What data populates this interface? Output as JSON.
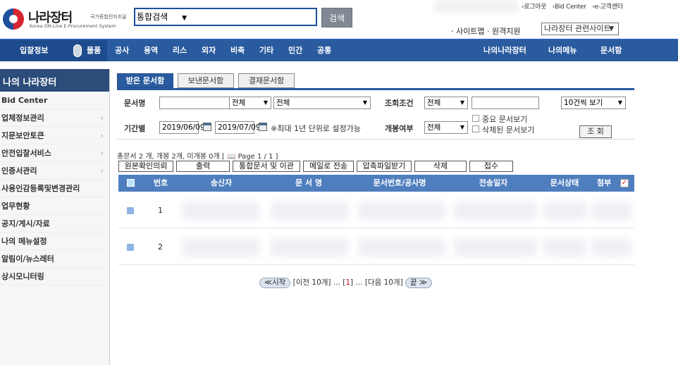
{
  "header": {
    "logo_name": "나라장터",
    "logo_tag": "국가종합전자조달",
    "logo_eng": "Korea ON-Line E-Procurement System",
    "search_scope": "통합검색",
    "search_button": "검색",
    "top_links": [
      "›로그아웃",
      "›Bid Center",
      "›e-고객센터"
    ],
    "sub_links": "· 사이트맵 · 원격지원",
    "related_sites": "나라장터 관련사이트"
  },
  "nav": {
    "items": [
      "입찰정보",
      "물품",
      "공사",
      "용역",
      "리스",
      "외자",
      "비축",
      "기타",
      "민간",
      "공통"
    ],
    "right_items": [
      "나의나라장터",
      "나의메뉴",
      "문서함"
    ]
  },
  "sidebar": {
    "title": "나의 나라장터",
    "items": [
      {
        "label": "Bid Center",
        "chev": false
      },
      {
        "label": "업체정보관리",
        "chev": true
      },
      {
        "label": "지문보안토큰",
        "chev": true
      },
      {
        "label": "안전입찰서비스",
        "chev": true
      },
      {
        "label": "인증서관리",
        "chev": true
      },
      {
        "label": "사용인감등록및변경관리",
        "chev": false
      },
      {
        "label": "업무현황",
        "chev": false
      },
      {
        "label": "공지/게시/자료",
        "chev": false
      },
      {
        "label": "나의 메뉴설정",
        "chev": false
      },
      {
        "label": "알림이/뉴스레터",
        "chev": false
      },
      {
        "label": "상시모니터링",
        "chev": false
      }
    ]
  },
  "tabs": [
    "받은 문서함",
    "보낸문서함",
    "결재문서함"
  ],
  "filters": {
    "doc_name_label": "문서명",
    "doc_type_1": "전체",
    "doc_type_2": "전체",
    "query_cond_label": "조회조건",
    "query_cond_value": "전체",
    "page_size": "10건씩 보기",
    "period_label": "기간별",
    "date_from": "2019/06/09",
    "date_to": "2019/07/09",
    "period_note": "※최대 1년 단위로 설정가능",
    "open_label": "개봉여부",
    "open_value": "전체",
    "important_label": "중요 문서보기",
    "deleted_label": "삭제된 문서보기",
    "query_button": "조 회"
  },
  "summary": "총문서 2 개, 개봉 2개, 미개봉 0개 [ 📖 Page 1 / 1 ]",
  "actions": [
    "원본확인의뢰",
    "출력",
    "통합문서 및 이관",
    "메일로 전송",
    "압축파일받기",
    "삭제",
    "접수"
  ],
  "table": {
    "headers": [
      "번호",
      "송신자",
      "문 서 명",
      "문서번호/공사명",
      "전송일자",
      "문서상태",
      "첨부"
    ],
    "rows": [
      {
        "num": "1"
      },
      {
        "num": "2"
      }
    ]
  },
  "pager": {
    "first": "≪시작",
    "prev": "[이전 10개]",
    "pages": "... [",
    "current": "1",
    "pages_after": "] ...",
    "next": "[다음 10개]",
    "last": "끝 ≫"
  }
}
